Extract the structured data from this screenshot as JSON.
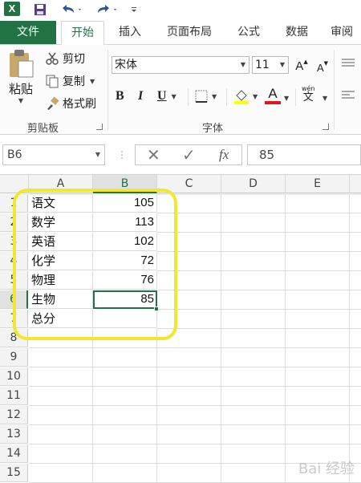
{
  "quick_access": {
    "app_logo": "X"
  },
  "tabs": {
    "file": "文件",
    "items": [
      "开始",
      "插入",
      "页面布局",
      "公式",
      "数据",
      "审阅"
    ],
    "active": "开始"
  },
  "clipboard": {
    "paste": "粘贴",
    "cut": "剪切",
    "copy": "复制",
    "format_painter": "格式刷",
    "group_label": "剪贴板"
  },
  "font": {
    "name": "宋体",
    "size": "11",
    "group_label": "字体",
    "bold": "B",
    "italic": "I",
    "underline": "U",
    "grow": "A",
    "shrink": "A",
    "wen": "wén",
    "wen_char": "文",
    "font_color": "A",
    "font_color_hex": "#e81123",
    "fill_color_hex": "#ffff00"
  },
  "formula_bar": {
    "name_box": "B6",
    "fx": "fx",
    "value": "85"
  },
  "sheet": {
    "columns": [
      "A",
      "B",
      "C",
      "D",
      "E"
    ],
    "selected_column": "B",
    "rows": [
      "1",
      "2",
      "3",
      "4",
      "5",
      "6",
      "7",
      "8",
      "9",
      "10",
      "11",
      "12",
      "13",
      "14",
      "15"
    ],
    "selected_row": "6",
    "data": [
      {
        "a": "语文",
        "b": "105"
      },
      {
        "a": "数学",
        "b": "113"
      },
      {
        "a": "英语",
        "b": "102"
      },
      {
        "a": "化学",
        "b": "72"
      },
      {
        "a": "物理",
        "b": "76"
      },
      {
        "a": "生物",
        "b": "85"
      },
      {
        "a": "总分",
        "b": ""
      }
    ]
  },
  "colors": {
    "accent": "#217346",
    "highlight": "#f4e531"
  },
  "watermark": "Bai 经验"
}
